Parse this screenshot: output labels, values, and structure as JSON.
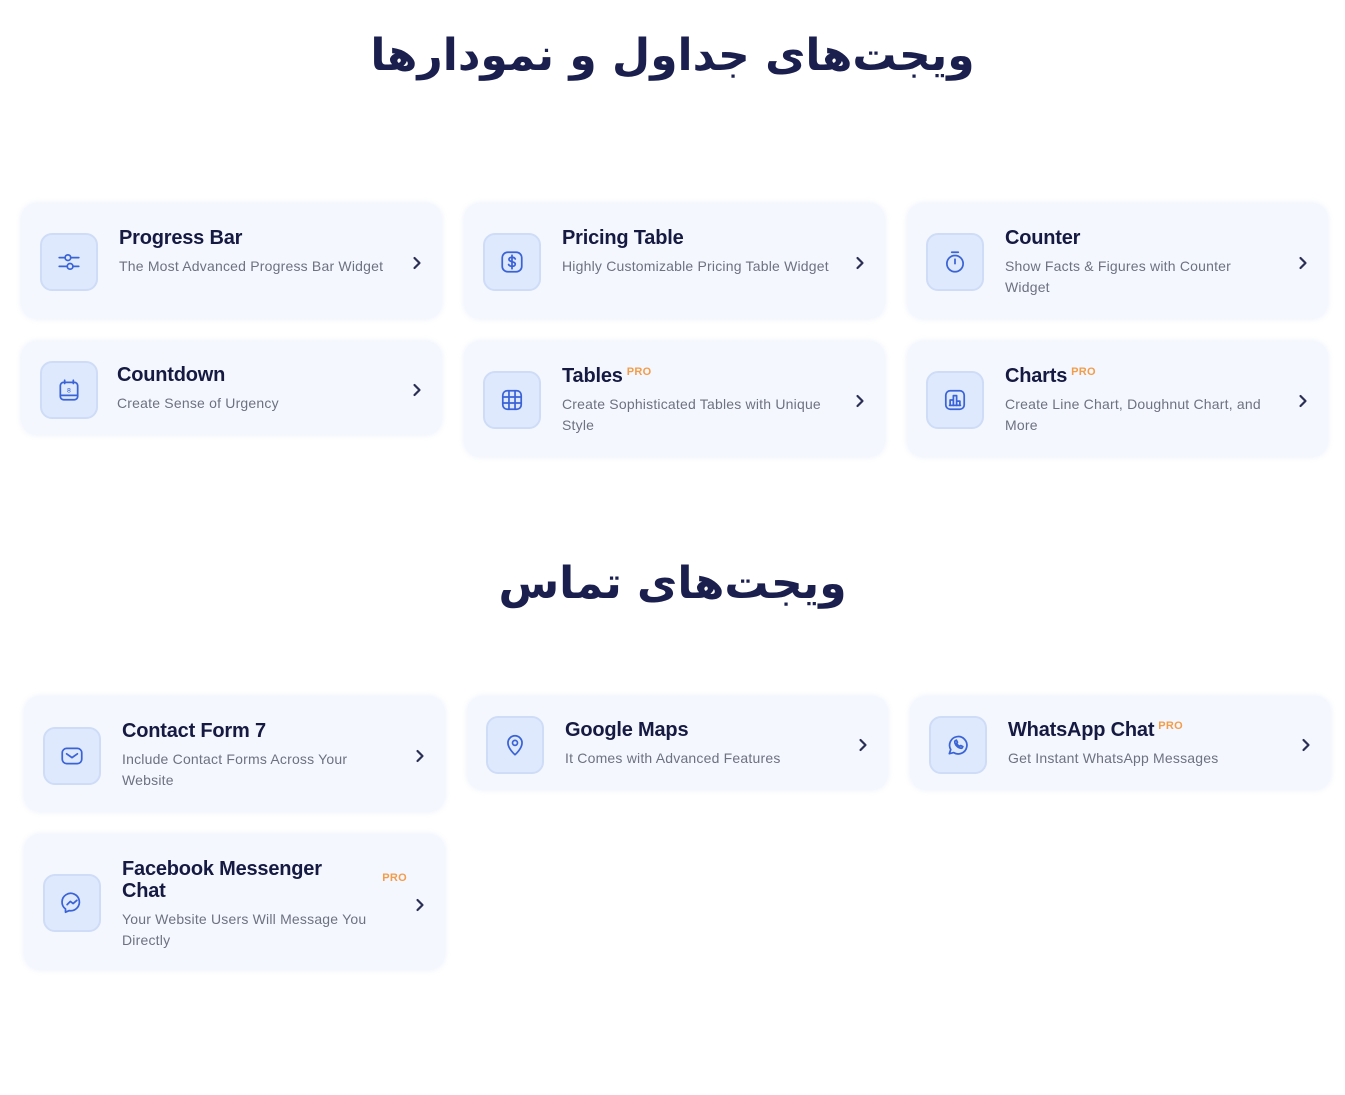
{
  "sections": [
    {
      "title": "ویجت‌های جداول و نمودارها",
      "cards": [
        {
          "title": "Progress Bar",
          "pro": "",
          "description": "The Most Advanced Progress Bar Widget",
          "icon": "sliders-icon"
        },
        {
          "title": "Pricing Table",
          "pro": "",
          "description": "Highly Customizable Pricing Table Widget",
          "icon": "dollar-icon"
        },
        {
          "title": "Counter",
          "pro": "",
          "description": "Show Facts & Figures with Counter Widget",
          "icon": "stopwatch-icon"
        },
        {
          "title": "Countdown",
          "pro": "",
          "description": "Create Sense of Urgency",
          "icon": "calendar-icon"
        },
        {
          "title": "Tables",
          "pro": "PRO",
          "description": "Create Sophisticated Tables with Unique Style",
          "icon": "grid-table-icon"
        },
        {
          "title": "Charts",
          "pro": "PRO",
          "description": "Create Line Chart, Doughnut Chart, and More",
          "icon": "bar-chart-icon"
        }
      ]
    },
    {
      "title": "ویجت‌های تماس",
      "cards": [
        {
          "title": "Contact Form 7",
          "pro": "",
          "description": "Include Contact Forms Across Your Website",
          "icon": "envelope-icon"
        },
        {
          "title": "Google Maps",
          "pro": "",
          "description": "It Comes with Advanced Features",
          "icon": "map-pin-icon"
        },
        {
          "title": "WhatsApp Chat",
          "pro": "PRO",
          "description": "Get Instant WhatsApp Messages",
          "icon": "whatsapp-icon"
        },
        {
          "title": "Facebook Messenger Chat",
          "pro": "PRO",
          "description": "Your Website Users Will Message You Directly",
          "icon": "messenger-icon"
        }
      ]
    }
  ],
  "colors": {
    "heading": "#1a1f4e",
    "card_bg": "#f4f8fe",
    "icon_bg": "#dee9fd",
    "icon_stroke": "#3a63d6",
    "pro_badge": "#f39c4a",
    "description": "#6e7180"
  }
}
